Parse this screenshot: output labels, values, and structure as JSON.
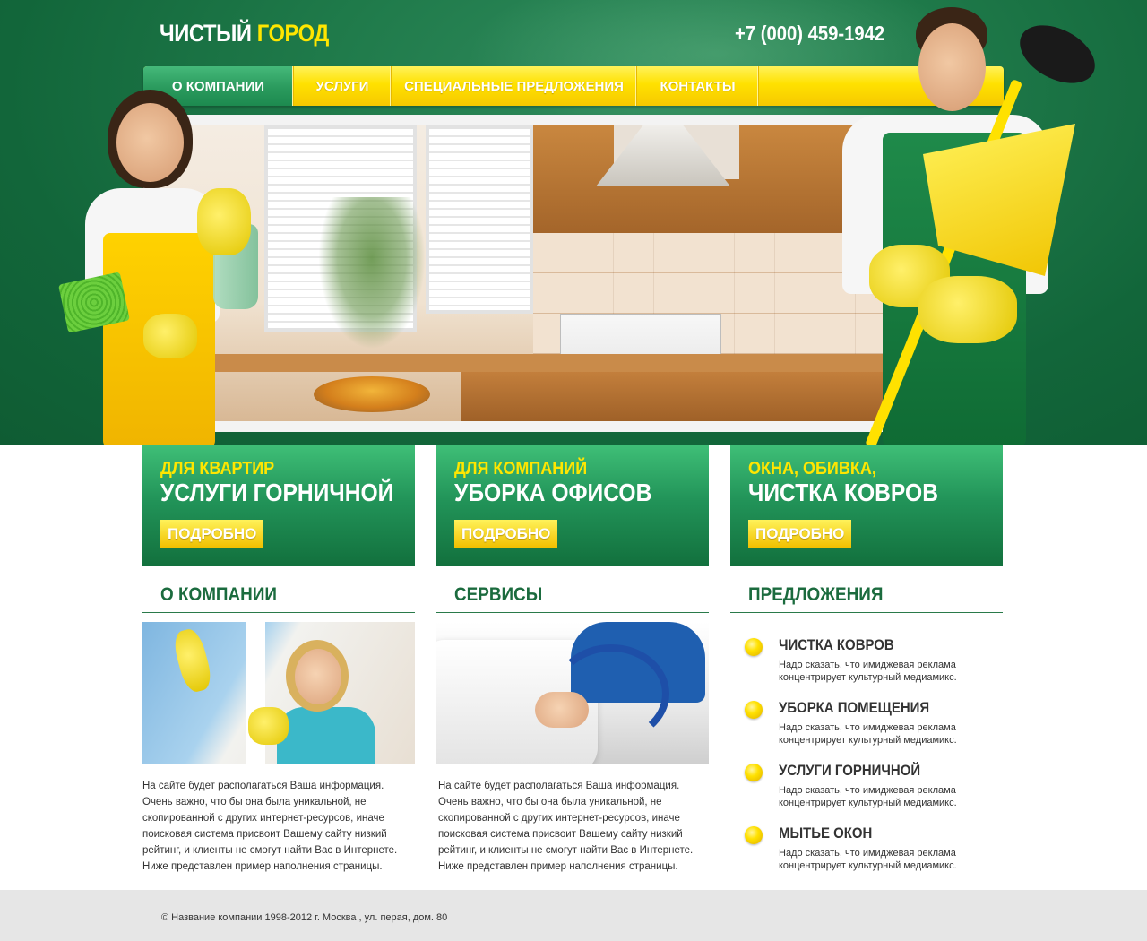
{
  "header": {
    "logo_main": "ЧИСТЫЙ",
    "logo_accent": "ГОРОД",
    "phone": "+7 (000) 459-1942"
  },
  "nav": {
    "items": [
      {
        "label": "О КОМПАНИИ",
        "active": true
      },
      {
        "label": "УСЛУГИ",
        "active": false
      },
      {
        "label": "СПЕЦИАЛЬНЫЕ ПРЕДЛОЖЕНИЯ",
        "active": false
      },
      {
        "label": "КОНТАКТЫ",
        "active": false
      }
    ]
  },
  "services": [
    {
      "subtitle": "ДЛЯ КВАРТИР",
      "title": "УСЛУГИ ГОРНИЧНОЙ",
      "button": "ПОДРОБНО"
    },
    {
      "subtitle": "ДЛЯ КОМПАНИЙ",
      "title": "УБОРКА ОФИСОВ",
      "button": "ПОДРОБНО"
    },
    {
      "subtitle": "ОКНА, ОБИВКА,",
      "title": "ЧИСТКА КОВРОВ",
      "button": "ПОДРОБНО"
    }
  ],
  "columns": {
    "about": {
      "heading": "О КОМПАНИИ",
      "text": "На сайте будет располагаться Ваша информация. Очень важно, что бы она была уникальной, не скопированной с других интернет-ресурсов, иначе поисковая система присвоит Вашему сайту низкий рейтинг, и клиенты не смогут найти Вас в Интернете. Ниже представлен пример наполнения страницы."
    },
    "services": {
      "heading": "СЕРВИСЫ",
      "text": "На сайте будет располагаться Ваша информация. Очень важно, что бы она была уникальной, не скопированной с других интернет-ресурсов, иначе поисковая система присвоит Вашему сайту низкий рейтинг, и клиенты не смогут найти Вас в Интернете. Ниже представлен пример наполнения страницы."
    },
    "offers": {
      "heading": "ПРЕДЛОЖЕНИЯ",
      "items": [
        {
          "title": "ЧИСТКА КОВРОВ",
          "text": "Надо сказать, что имиджевая реклама концентрирует культурный медиамикс."
        },
        {
          "title": "УБОРКА ПОМЕЩЕНИЯ",
          "text": "Надо сказать, что имиджевая реклама концентрирует культурный медиамикс."
        },
        {
          "title": "УСЛУГИ ГОРНИЧНОЙ",
          "text": "Надо сказать, что имиджевая реклама концентрирует культурный медиамикс."
        },
        {
          "title": "МЫТЬЕ ОКОН",
          "text": "Надо сказать, что имиджевая реклама концентрирует культурный медиамикс."
        }
      ]
    }
  },
  "footer": {
    "text": "© Название компании 1998-2012 г. Москва , ул. перая, дом. 80"
  },
  "colors": {
    "brand_green": "#1f7a4a",
    "accent_yellow": "#ffe100",
    "heading_green": "#1b6b3e"
  }
}
